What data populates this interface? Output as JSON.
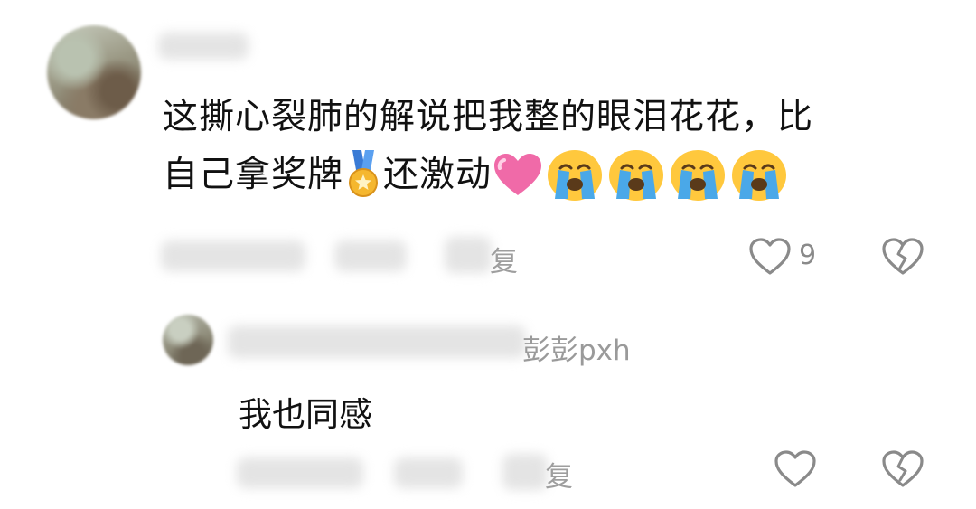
{
  "comment": {
    "line1": "这撕心裂肺的解说把我整的眼泪花花，比",
    "line2_a": "自己拿奖牌",
    "line2_b": "还激动",
    "emojis": [
      "medal-icon",
      "pink-heart-icon",
      "crying-face-icon",
      "crying-face-icon",
      "crying-face-icon",
      "crying-face-icon"
    ],
    "reply_label": "复",
    "like_count": "9"
  },
  "reply": {
    "username_suffix": "彭彭pxh",
    "text": "我也同感",
    "reply_label": "复"
  },
  "colors": {
    "text": "#111111",
    "meta": "#b0b0b0",
    "icon": "#8a8a8a",
    "emoji_face": "#ffc83d",
    "emoji_tears": "#4aa8e8",
    "heart_pink": "#f06aa8"
  }
}
